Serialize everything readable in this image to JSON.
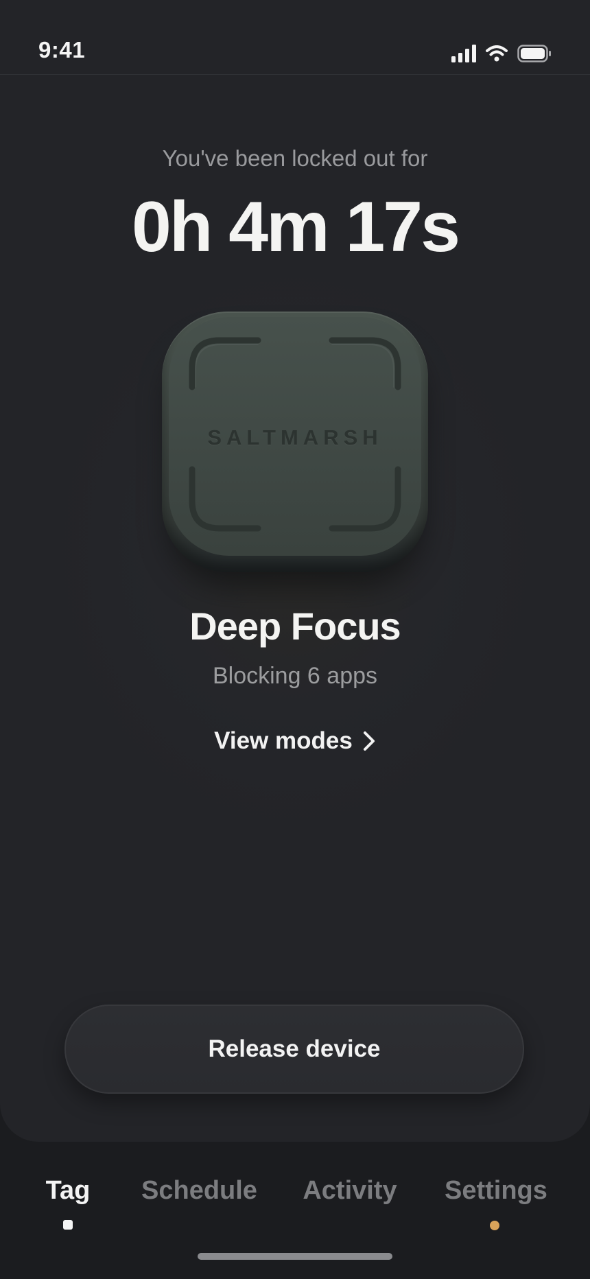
{
  "status_bar": {
    "time": "9:41"
  },
  "lockout": {
    "caption": "You've been locked out for",
    "timer": "0h 4m 17s"
  },
  "device": {
    "label": "SALTMARSH"
  },
  "mode": {
    "name": "Deep Focus",
    "subtitle": "Blocking 6 apps",
    "view_modes_label": "View modes"
  },
  "release_button": {
    "label": "Release device"
  },
  "tabs": [
    {
      "label": "Tag",
      "active": true,
      "indicator": "square",
      "indicator_color": "#f4f4f4"
    },
    {
      "label": "Schedule",
      "active": false
    },
    {
      "label": "Activity",
      "active": false
    },
    {
      "label": "Settings",
      "active": false,
      "indicator": "dot",
      "indicator_color": "#d9a35a"
    }
  ],
  "colors": {
    "background": "#232428",
    "accent_dot": "#d9a35a",
    "device_body": "#3f4844"
  }
}
